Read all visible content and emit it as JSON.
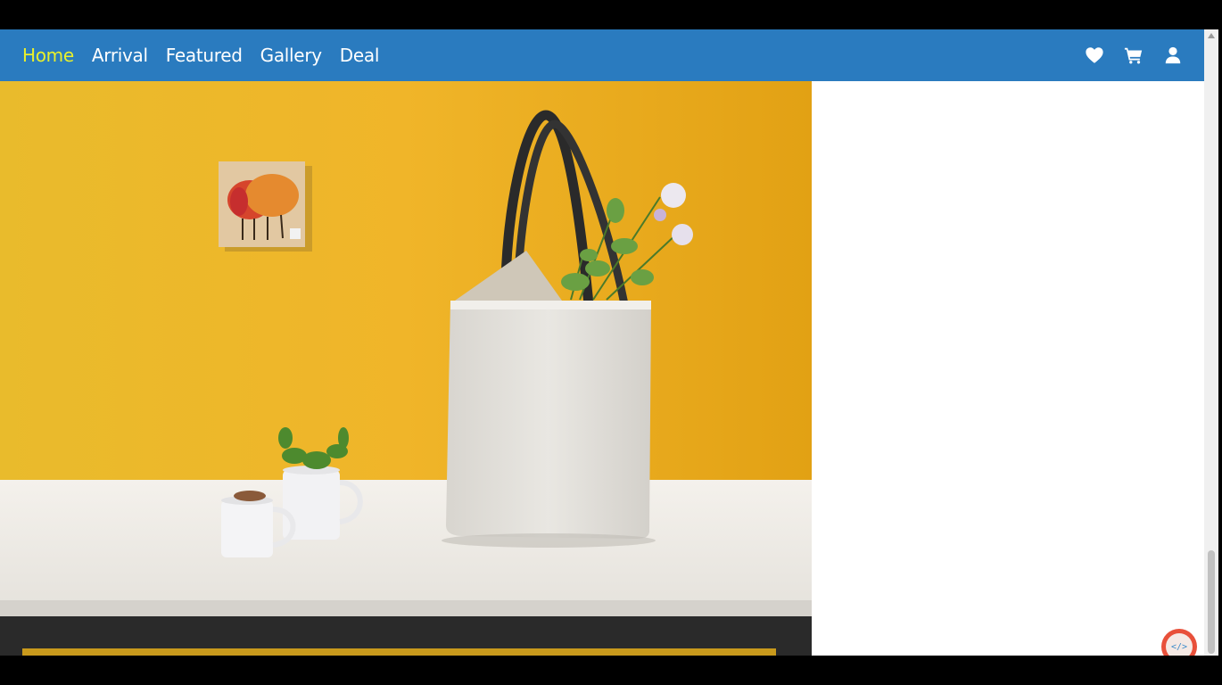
{
  "nav": {
    "items": [
      {
        "label": "Home",
        "active": true
      },
      {
        "label": "Arrival",
        "active": false
      },
      {
        "label": "Featured",
        "active": false
      },
      {
        "label": "Gallery",
        "active": false
      },
      {
        "label": "Deal",
        "active": false
      }
    ],
    "active_color": "#e9f02b",
    "background": "#2a7bbf",
    "icons": [
      "heart-icon",
      "cart-icon",
      "user-icon"
    ]
  },
  "hero": {
    "image": "photo: white tote bag with flowers on a table against a yellow wall, with two white mugs and a small framed painting"
  },
  "badge": {
    "text": "</>"
  }
}
